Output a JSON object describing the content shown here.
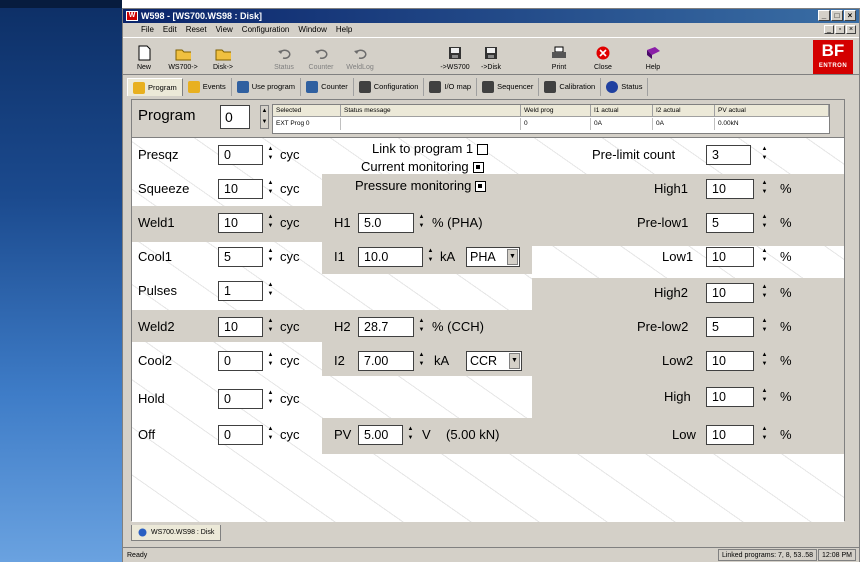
{
  "window": {
    "title": "W598 - [WS700.WS98 : Disk]",
    "app_badge": "W"
  },
  "menu": [
    "File",
    "Edit",
    "Reset",
    "View",
    "Configuration",
    "Window",
    "Help"
  ],
  "toolbar": [
    {
      "label": "New",
      "icon": "new-file-icon",
      "enabled": true
    },
    {
      "label": "WS700->",
      "icon": "folder-open-icon",
      "enabled": true
    },
    {
      "label": "Disk->",
      "icon": "folder-open-icon",
      "enabled": true
    },
    {
      "label": "Status",
      "icon": "undo-arrow-icon",
      "enabled": false
    },
    {
      "label": "Counter",
      "icon": "undo-arrow-icon",
      "enabled": false
    },
    {
      "label": "WeldLog",
      "icon": "undo-arrow-icon",
      "enabled": false
    },
    {
      "label": "->WS700",
      "icon": "save-disk-icon",
      "enabled": true
    },
    {
      "label": "->Disk",
      "icon": "save-disk-icon",
      "enabled": true
    },
    {
      "label": "Print",
      "icon": "printer-icon",
      "enabled": true
    },
    {
      "label": "Close",
      "icon": "close-circle-icon",
      "enabled": true
    },
    {
      "label": "Help",
      "icon": "help-book-icon",
      "enabled": true
    }
  ],
  "logo": {
    "line1": "BF",
    "line2": "ENTRON",
    "color": "#d40000"
  },
  "tabs": [
    {
      "label": "Program",
      "active": true
    },
    {
      "label": "Events",
      "active": false
    },
    {
      "label": "Use program",
      "active": false
    },
    {
      "label": "Counter",
      "active": false
    },
    {
      "label": "Configuration",
      "active": false
    },
    {
      "label": "I/O map",
      "active": false
    },
    {
      "label": "Sequencer",
      "active": false
    },
    {
      "label": "Calibration",
      "active": false
    },
    {
      "label": "Status",
      "active": false
    }
  ],
  "program": {
    "label": "Program",
    "value": "0"
  },
  "program_table": {
    "headers": [
      "Selected",
      "Status message",
      "Weld prog",
      "I1 actual",
      "I2 actual",
      "PV actual"
    ],
    "row": [
      "EXT Prog 0",
      "",
      "0",
      "0A",
      "0A",
      "0.00kN"
    ]
  },
  "form": {
    "presqz": {
      "label": "Presqz",
      "value": "0",
      "unit": "cyc"
    },
    "squeeze": {
      "label": "Squeeze",
      "value": "10",
      "unit": "cyc"
    },
    "weld1": {
      "label": "Weld1",
      "value": "10",
      "unit": "cyc"
    },
    "cool1": {
      "label": "Cool1",
      "value": "5",
      "unit": "cyc"
    },
    "pulses": {
      "label": "Pulses",
      "value": "1"
    },
    "weld2": {
      "label": "Weld2",
      "value": "10",
      "unit": "cyc"
    },
    "cool2": {
      "label": "Cool2",
      "value": "0",
      "unit": "cyc"
    },
    "hold": {
      "label": "Hold",
      "value": "0",
      "unit": "cyc"
    },
    "off": {
      "label": "Off",
      "value": "0",
      "unit": "cyc"
    },
    "link_program": {
      "label": "Link to program 1",
      "checked": false
    },
    "current_monitoring": {
      "label": "Current monitoring",
      "checked": true
    },
    "pressure_monitoring": {
      "label": "Pressure monitoring",
      "checked": true
    },
    "h1": {
      "label": "H1",
      "value": "5.0",
      "unit": "% (PHA)"
    },
    "i1": {
      "label": "I1",
      "value": "10.0",
      "unit": "kA",
      "mode": "PHA"
    },
    "h2": {
      "label": "H2",
      "value": "28.7",
      "unit": "% (CCH)"
    },
    "i2": {
      "label": "I2",
      "value": "7.00",
      "unit": "kA",
      "mode": "CCR"
    },
    "pv": {
      "label": "PV",
      "value": "5.00",
      "unit": "V",
      "note": "(5.00 kN)"
    },
    "pre_limit_count": {
      "label": "Pre-limit count",
      "value": "3"
    },
    "high1": {
      "label": "High1",
      "value": "10",
      "unit": "%"
    },
    "pre_low1": {
      "label": "Pre-low1",
      "value": "5",
      "unit": "%"
    },
    "low1": {
      "label": "Low1",
      "value": "10",
      "unit": "%"
    },
    "high2": {
      "label": "High2",
      "value": "10",
      "unit": "%"
    },
    "pre_low2": {
      "label": "Pre-low2",
      "value": "5",
      "unit": "%"
    },
    "low2": {
      "label": "Low2",
      "value": "10",
      "unit": "%"
    },
    "high": {
      "label": "High",
      "value": "10",
      "unit": "%"
    },
    "low": {
      "label": "Low",
      "value": "10",
      "unit": "%"
    }
  },
  "doc_tab": "WS700.WS98 : Disk",
  "status": {
    "ready": "Ready",
    "linked": "Linked programs: 7, 8, 53..58",
    "time": "12:08 PM"
  }
}
